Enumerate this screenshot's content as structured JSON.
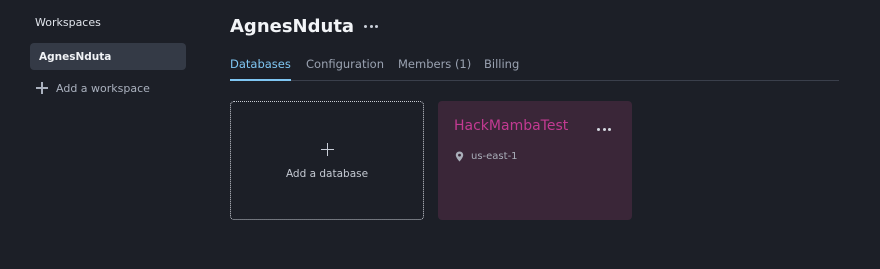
{
  "sidebar": {
    "title": "Workspaces",
    "items": [
      {
        "label": "AgnesNduta",
        "selected": true
      }
    ],
    "add_label": "Add a workspace"
  },
  "workspace": {
    "title": "AgnesNduta",
    "tabs": [
      {
        "label": "Databases",
        "active": true
      },
      {
        "label": "Configuration",
        "active": false
      },
      {
        "label": "Members (1)",
        "active": false
      },
      {
        "label": "Billing",
        "active": false
      }
    ]
  },
  "databases": {
    "add_label": "Add a database",
    "items": [
      {
        "name": "HackMambaTest",
        "region": "us-east-1"
      }
    ]
  },
  "colors": {
    "background": "#1c1f27",
    "accent_tab": "#7fc6f2",
    "db_name": "#c33a92",
    "db_card_bg": "#3a2638",
    "selected_ws_bg": "#343a46"
  },
  "icons": [
    "plus-icon",
    "more-icon",
    "location-pin-icon"
  ]
}
